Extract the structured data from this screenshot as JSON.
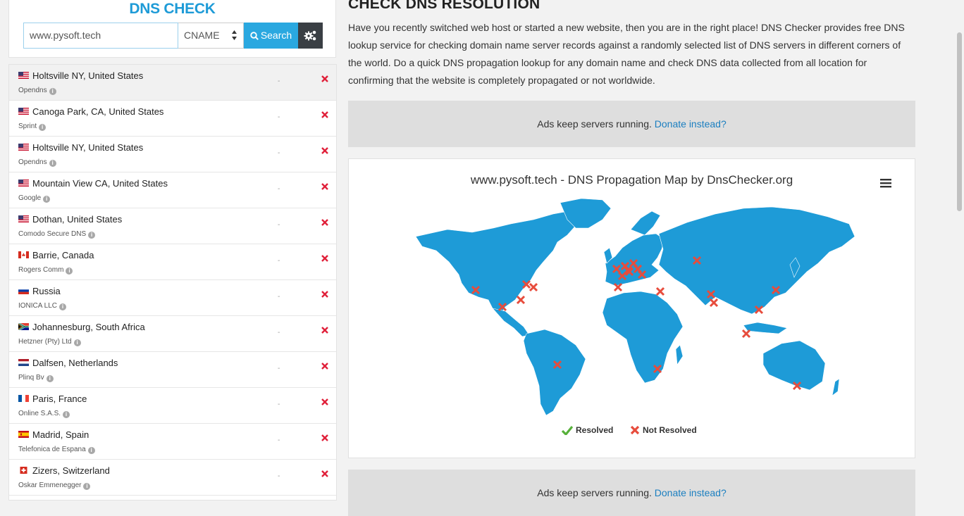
{
  "search": {
    "title": "DNS CHECK",
    "domain_value": "www.pysoft.tech",
    "record_type": "CNAME",
    "search_label": "Search",
    "settings_icon": "gears-icon"
  },
  "results": [
    {
      "location": "Holtsville NY, United States",
      "provider": "Opendns",
      "flag": "us-flag",
      "result": "-",
      "status": "not-resolved"
    },
    {
      "location": "Canoga Park, CA, United States",
      "provider": "Sprint",
      "flag": "us-flag",
      "result": "-",
      "status": "not-resolved"
    },
    {
      "location": "Holtsville NY, United States",
      "provider": "Opendns",
      "flag": "us-flag",
      "result": "-",
      "status": "not-resolved"
    },
    {
      "location": "Mountain View CA, United States",
      "provider": "Google",
      "flag": "us-flag",
      "result": "-",
      "status": "not-resolved"
    },
    {
      "location": "Dothan, United States",
      "provider": "Comodo Secure DNS",
      "flag": "us-flag",
      "result": "-",
      "status": "not-resolved"
    },
    {
      "location": "Barrie, Canada",
      "provider": "Rogers Comm",
      "flag": "ca-flag",
      "result": "-",
      "status": "not-resolved"
    },
    {
      "location": "Russia",
      "provider": "IONICA LLC",
      "flag": "ru-flag",
      "result": "-",
      "status": "not-resolved"
    },
    {
      "location": "Johannesburg, South Africa",
      "provider": "Hetzner (Pty) Ltd",
      "flag": "za-flag",
      "result": "-",
      "status": "not-resolved"
    },
    {
      "location": "Dalfsen, Netherlands",
      "provider": "Plinq Bv",
      "flag": "nl-flag",
      "result": "-",
      "status": "not-resolved"
    },
    {
      "location": "Paris, France",
      "provider": "Online S.A.S.",
      "flag": "fr-flag",
      "result": "-",
      "status": "not-resolved"
    },
    {
      "location": "Madrid, Spain",
      "provider": "Telefonica de Espana",
      "flag": "es-flag",
      "result": "-",
      "status": "not-resolved"
    },
    {
      "location": "Zizers, Switzerland",
      "provider": "Oskar Emmenegger",
      "flag": "ch-flag",
      "result": "-",
      "status": "not-resolved"
    }
  ],
  "main": {
    "title": "CHECK DNS RESOLUTION",
    "intro": "Have you recently switched web host or started a new website, then you are in the right place! DNS Checker provides free DNS lookup service for checking domain name server records against a randomly selected list of DNS servers in different corners of the world. Do a quick DNS propagation lookup for any domain name and check DNS data collected from all location for confirming that the website is completely propagated or not worldwide."
  },
  "ad": {
    "text": "Ads keep servers running.",
    "link": "Donate instead?"
  },
  "map": {
    "title": "www.pysoft.tech - DNS Propagation Map by DnsChecker.org",
    "legend_resolved": "Resolved",
    "legend_not_resolved": "Not Resolved",
    "land_color": "#1e9bd7",
    "marker_color": "#e74c3c"
  },
  "colors": {
    "accent": "#1e9bd7",
    "search_button": "#2aa8e0",
    "settings_button": "#3a3f44",
    "fail": "#e0203a"
  }
}
